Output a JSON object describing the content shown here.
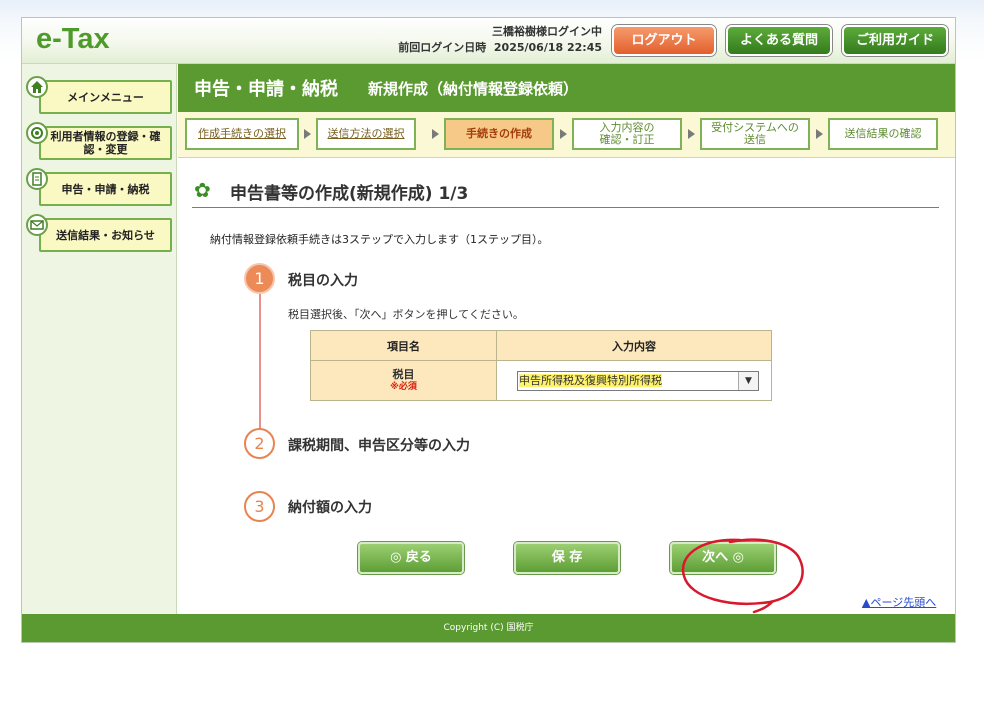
{
  "header": {
    "logo": "e-Tax",
    "user_login": "三橋裕樹様ログイン中",
    "last_login_label": "前回ログイン日時",
    "last_login_value": "2025/06/18 22:45",
    "logout": "ログアウト",
    "faq": "よくある質問",
    "guide": "ご利用ガイド"
  },
  "sidebar": {
    "items": [
      {
        "label": "メインメニュー",
        "icon": "home-icon"
      },
      {
        "label": "利用者情報の登録・確認・変更",
        "icon": "user-settings-icon"
      },
      {
        "label": "申告・申請・納税",
        "icon": "document-icon"
      },
      {
        "label": "送信結果・お知らせ",
        "icon": "mail-icon"
      }
    ]
  },
  "main": {
    "category": "申告・申請・納税",
    "subtitle": "新規作成（納付情報登録依頼）",
    "steps": [
      {
        "label": "作成手続きの選択",
        "state": "done"
      },
      {
        "label": "送信方法の選択",
        "state": "done"
      },
      {
        "label": "手続きの作成",
        "state": "active"
      },
      {
        "label_line1": "入力内容の",
        "label_line2": "確認・訂正",
        "state": "todo"
      },
      {
        "label_line1": "受付システムへの",
        "label_line2": "送信",
        "state": "todo"
      },
      {
        "label": "送信結果の確認",
        "state": "todo"
      }
    ],
    "page_title": "申告書等の作成(新規作成) 1/3",
    "intro": "納付情報登録依頼手続きは3ステップで入力します（1ステップ目）。",
    "sections": [
      {
        "num": "1",
        "title": "税目の入力"
      },
      {
        "num": "2",
        "title": "課税期間、申告区分等の入力"
      },
      {
        "num": "3",
        "title": "納付額の入力"
      }
    ],
    "section1_hint": "税目選択後、「次へ」ボタンを押してください。",
    "table": {
      "col1": "項目名",
      "col2": "入力内容",
      "row_label": "税目",
      "required": "※必須",
      "selected_value": "申告所得税及復興特別所得税"
    },
    "buttons": {
      "back": "◎ 戻る",
      "save": "保 存",
      "next": "次へ ◎"
    },
    "page_top": "ページ先頭へ"
  },
  "footer": {
    "copyright": "Copyright (C) 国税庁"
  },
  "colors": {
    "brand_green": "#5b9a31",
    "logout_orange": "#e2602c",
    "active_step": "#f7c988",
    "annotation_red": "#d8182b"
  }
}
